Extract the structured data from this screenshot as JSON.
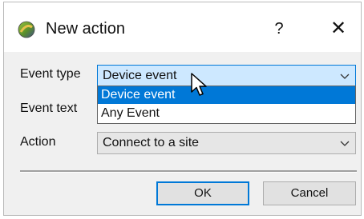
{
  "window": {
    "title": "New action",
    "help_label": "?",
    "close_label": "✕"
  },
  "form": {
    "event_type": {
      "label": "Event type",
      "value": "Device event",
      "options": [
        "Device event",
        "Any Event"
      ],
      "expanded": true,
      "highlighted_option": "Device event"
    },
    "event_text": {
      "label": "Event text"
    },
    "action": {
      "label": "Action",
      "value": "Connect to a site"
    }
  },
  "buttons": {
    "ok_label": "OK",
    "cancel_label": "Cancel"
  },
  "icons": {
    "app": "app-icon",
    "chevron": "chevron-down-icon",
    "cursor": "mouse-cursor-icon"
  },
  "colors": {
    "accent": "#0078d7",
    "combo_focus_bg": "#cde8ff",
    "dialog_bg": "#f0f0f0"
  }
}
